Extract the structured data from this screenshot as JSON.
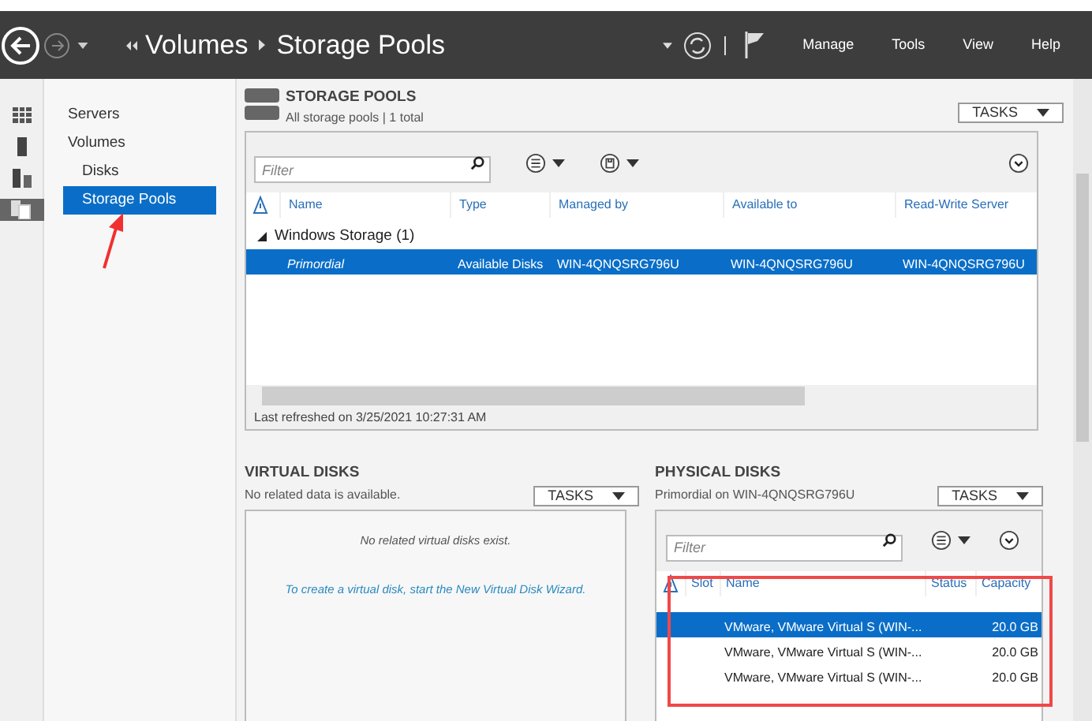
{
  "header": {
    "breadcrumb": [
      "Volumes",
      "Storage Pools"
    ],
    "menu": [
      "Manage",
      "Tools",
      "View",
      "Help"
    ]
  },
  "icon_strip": [
    {
      "kind": "grid",
      "selected": false
    },
    {
      "kind": "server",
      "selected": false
    },
    {
      "kind": "servers",
      "selected": false
    },
    {
      "kind": "files",
      "selected": true
    }
  ],
  "sidebar": {
    "items": [
      {
        "label": "Servers",
        "selected": false
      },
      {
        "label": "Volumes",
        "selected": false,
        "children": [
          {
            "label": "Disks",
            "selected": false
          },
          {
            "label": "Storage Pools",
            "selected": true
          }
        ]
      }
    ]
  },
  "storage_pools": {
    "title": "STORAGE POOLS",
    "subtitle": "All storage pools | 1 total",
    "tasks": "TASKS",
    "filter_placeholder": "Filter",
    "columns": [
      "Name",
      "Type",
      "Managed by",
      "Available to",
      "Read-Write Server"
    ],
    "groups": [
      {
        "label": "Windows Storage (1)",
        "expanded": true,
        "rows": [
          {
            "cells": [
              "Primordial",
              "Available Disks",
              "WIN-4QNQSRG796U",
              "WIN-4QNQSRG796U",
              "WIN-4QNQSRG796U"
            ],
            "selected": true
          }
        ]
      }
    ],
    "status": "Last refreshed on 3/25/2021 10:27:31 AM"
  },
  "virtual_disks": {
    "title": "VIRTUAL DISKS",
    "subtitle": "No related data is available.",
    "tasks": "TASKS",
    "message": "No related virtual disks exist.",
    "link": "To create a virtual disk, start the New Virtual Disk Wizard."
  },
  "physical_disks": {
    "title": "PHYSICAL DISKS",
    "subtitle": "Primordial on WIN-4QNQSRG796U",
    "tasks": "TASKS",
    "filter_placeholder": "Filter",
    "columns": [
      "Slot",
      "Name",
      "Status",
      "Capacity"
    ],
    "rows": [
      {
        "cells": [
          "",
          "VMware, VMware Virtual S (WIN-...",
          "",
          "20.0 GB"
        ],
        "selected": true
      },
      {
        "cells": [
          "",
          "VMware, VMware Virtual S (WIN-...",
          "",
          "20.0 GB"
        ],
        "selected": false
      },
      {
        "cells": [
          "",
          "VMware, VMware Virtual S (WIN-...",
          "",
          "20.0 GB"
        ],
        "selected": false
      }
    ]
  }
}
